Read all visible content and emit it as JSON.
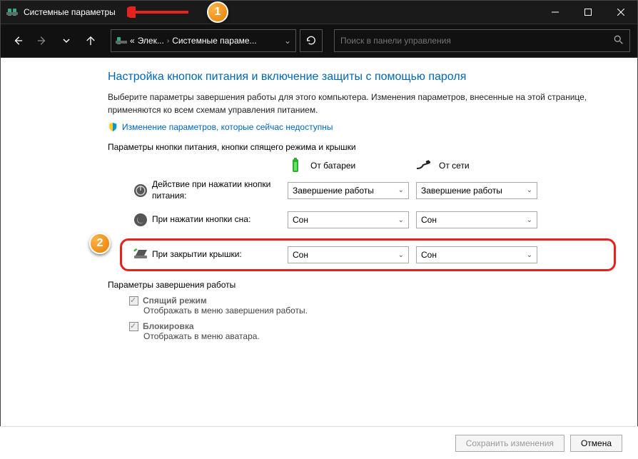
{
  "window": {
    "title": "Системные параметры"
  },
  "breadcrumb": {
    "seg0_prefix": "«",
    "seg1": "Элек...",
    "seg2": "Системные параме..."
  },
  "search": {
    "placeholder": "Поиск в панели управления"
  },
  "content": {
    "heading": "Настройка кнопок питания и включение защиты с помощью пароля",
    "desc": "Выберите параметры завершения работы для этого компьютера. Изменения параметров, внесенные на этой странице, применяются ко всем схемам управления питанием.",
    "shield_link": "Изменение параметров, которые сейчас недоступны",
    "section1": "Параметры кнопки питания, кнопки спящего режима и крышки",
    "col_battery": "От батареи",
    "col_ac": "От сети",
    "row_power": "Действие при нажатии кнопки питания:",
    "row_sleep": "При нажатии кнопки сна:",
    "row_lid": "При закрытии крышки:",
    "opt_shutdown": "Завершение работы",
    "opt_sleep": "Сон",
    "section2": "Параметры завершения работы",
    "chk_sleep": "Спящий режим",
    "chk_sleep_sub": "Отображать в меню завершения работы.",
    "chk_lock": "Блокировка",
    "chk_lock_sub": "Отображать в меню аватара."
  },
  "footer": {
    "save": "Сохранить изменения",
    "cancel": "Отмена"
  },
  "callouts": {
    "c1": "1",
    "c2": "2"
  }
}
